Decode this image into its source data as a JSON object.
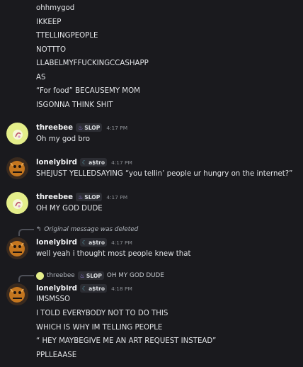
{
  "continuation_lines": [
    "ohhmygod",
    "IKKEEP",
    "TTELLINGPEOPLE",
    "NOTTTO",
    "LLABELMYFFUCKINGCCASHAPP",
    "AS",
    "“For food” BECAUSEMY MOM",
    "ISGONNA THINK SHIT"
  ],
  "messages": [
    {
      "user": "threebee",
      "tag": "SLOP",
      "tag_icon": "flame-icon",
      "time": "4:17 PM",
      "lines": [
        "Oh my god bro"
      ]
    },
    {
      "user": "lonelybird",
      "tag": "a$tro",
      "tag_icon": "moon-icon",
      "time": "4:17 PM",
      "lines": [
        "SHEJUST YELLEDSAYING “you tellin’ people ur hungry on the internet?”"
      ]
    },
    {
      "user": "threebee",
      "tag": "SLOP",
      "tag_icon": "flame-icon",
      "time": "4:17 PM",
      "lines": [
        "OH MY GOD DUDE"
      ]
    },
    {
      "reply": {
        "text": "Original message was deleted",
        "icon": "reply-arrow-icon"
      },
      "user": "lonelybird",
      "tag": "a$tro",
      "tag_icon": "moon-icon",
      "time": "4:17 PM",
      "lines": [
        "well yeah i thought most people knew that"
      ]
    },
    {
      "reply": {
        "user": "threebee",
        "tag": "SLOP",
        "text": "OH MY GOD DUDE"
      },
      "user": "lonelybird",
      "tag": "a$tro",
      "tag_icon": "moon-icon",
      "time": "4:18 PM",
      "lines": [
        "IMSMSSO",
        "I TOLD EVERYBODY NOT TO DO THIS",
        "WHICH IS WHY IM TELLING PEOPLE",
        "“ HEY MAYBEGIVE ME AN ART REQUEST INSTEAD”",
        "PPLLEAASE"
      ]
    }
  ],
  "colors": {
    "background": "#1a1a1e",
    "threebee_avatar": "#e4ee8a",
    "lonelybird_avatar": "#3a2a1e",
    "tag_bg": "#2c2d33"
  }
}
